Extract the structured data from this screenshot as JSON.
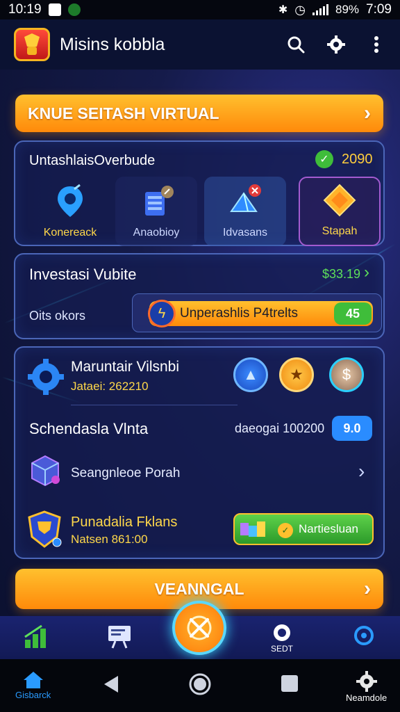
{
  "status": {
    "time_left": "10:19",
    "battery": "89%",
    "time_right": "7:09"
  },
  "header": {
    "title": "Misins kobbla"
  },
  "top_banner": {
    "label": "KNUE SEITASH VIRTUAL"
  },
  "categories_card": {
    "title": "UntashlaisOverbude",
    "count": "2090",
    "tiles": [
      {
        "label": "Konereack",
        "icon": "location-pin-icon"
      },
      {
        "label": "Anaobioy",
        "icon": "server-icon"
      },
      {
        "label": "Idvasans",
        "icon": "pyramid-icon"
      },
      {
        "label": "Stapah",
        "icon": "diamond-icon"
      }
    ]
  },
  "invest_card": {
    "title": "Investasi Vubite",
    "amount": "$33.19",
    "sub_label": "Oits okors",
    "progress_label": "Unperashlis P4trelts",
    "progress_badge": "45"
  },
  "details_card": {
    "item1": {
      "title": "Maruntair Vilsnbi",
      "sub": "Jataei: 262210"
    },
    "item2": {
      "title": "Schendasla Vlnta",
      "value": "daeogai 100200",
      "badge": "9.0"
    },
    "item3": {
      "title": "Seangnleoe Porah"
    },
    "item4": {
      "title": "Punadalia Fklans",
      "sub": "Natsen 861:00",
      "button": "Nartiesluan"
    }
  },
  "cta_bar": {
    "label": "VEANNGAL"
  },
  "bottom_nav": {
    "item_label": "SEDT"
  },
  "sys_nav": {
    "left_label": "Gisbarck",
    "right_label": "Neamdole"
  },
  "colors": {
    "orange": "#ff9a12",
    "green": "#3fbd3a",
    "blue": "#2a8cff",
    "card_border": "#4b66b8"
  }
}
